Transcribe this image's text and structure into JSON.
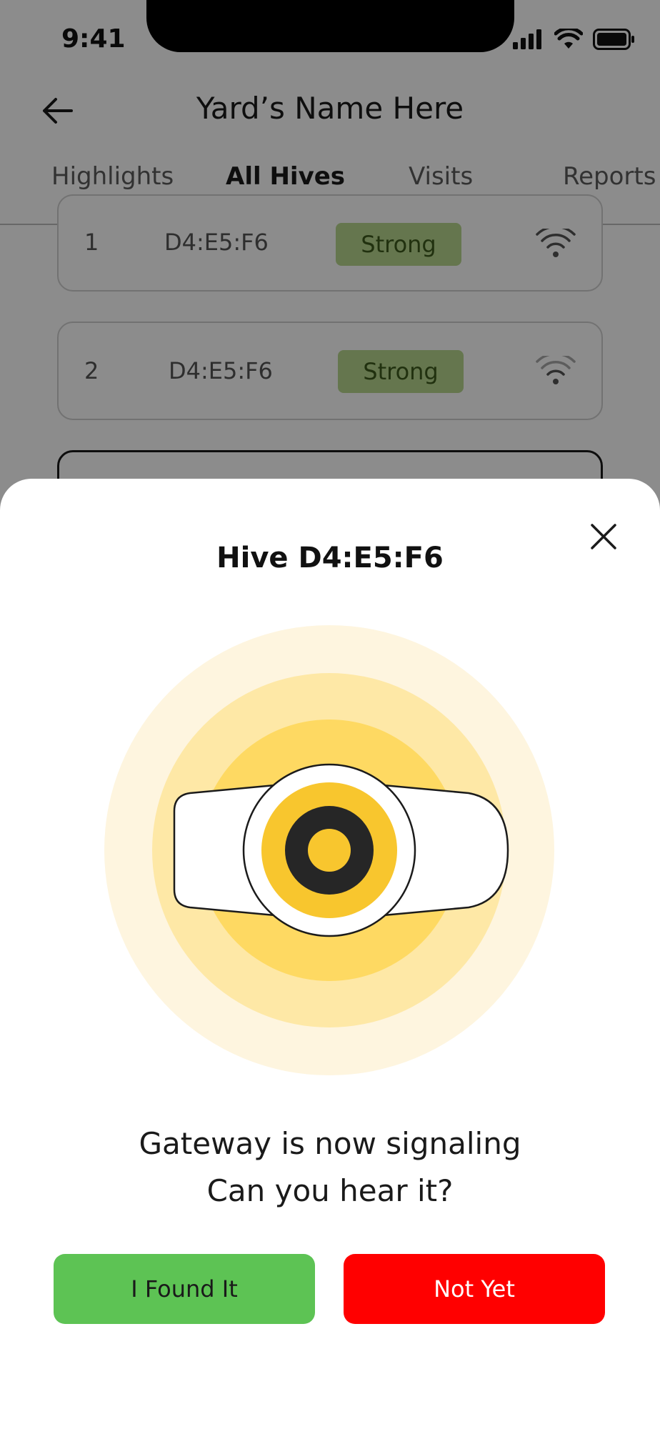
{
  "status_bar": {
    "time": "9:41"
  },
  "header": {
    "title": "Yard’s Name Here"
  },
  "tabs": [
    {
      "label": "Highlights"
    },
    {
      "label": "All Hives"
    },
    {
      "label": "Visits"
    },
    {
      "label": "Reports"
    }
  ],
  "active_tab": "All Hives",
  "hives": [
    {
      "number": "1",
      "mac": "D4:E5:F6",
      "status": "Strong"
    },
    {
      "number": "2",
      "mac": "D4:E5:F6",
      "status": "Strong"
    }
  ],
  "sheet": {
    "title": "Hive D4:E5:F6",
    "message_line1": "Gateway is now signaling",
    "message_line2": "Can you hear it?",
    "found_label": "I Found It",
    "notyet_label": "Not Yet"
  },
  "colors": {
    "accent_yellow": "#F8C62E",
    "found_green": "#5DC354",
    "notyet_red": "#FF0000",
    "strong_badge": "#B9D88F"
  }
}
